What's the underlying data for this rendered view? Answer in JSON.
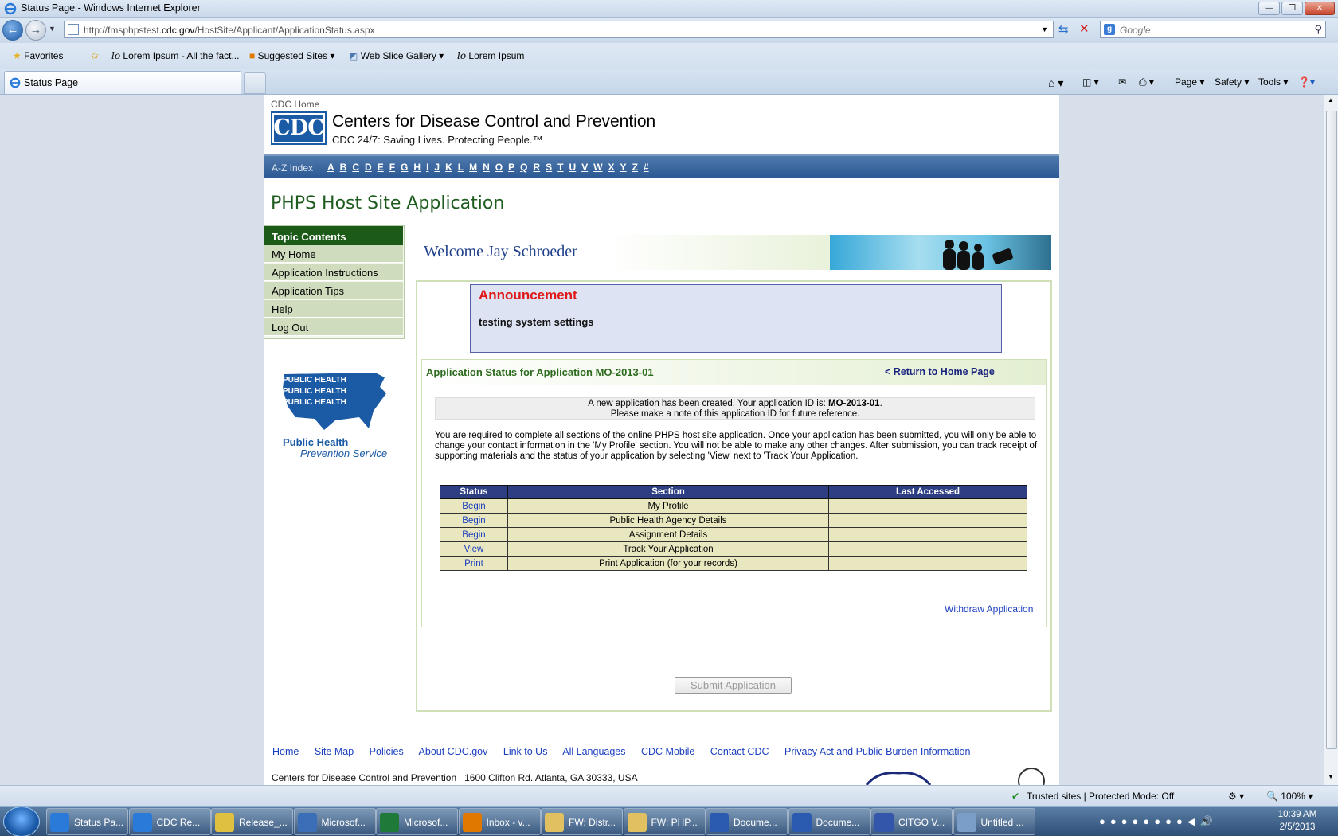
{
  "window": {
    "title": "Status Page - Windows Internet Explorer"
  },
  "browser": {
    "url_prefix": "http://fmsphpstest.",
    "url_domain": "cdc.gov",
    "url_path": "/HostSite/Applicant/ApplicationStatus.aspx",
    "search_placeholder": "Google"
  },
  "favorites": {
    "favorites_label": "Favorites",
    "items": [
      "Lorem Ipsum - All the fact...",
      "Suggested Sites",
      "Web Slice Gallery",
      "Lorem Ipsum"
    ]
  },
  "tabs": {
    "active": "Status Page"
  },
  "commandbar": {
    "page": "Page",
    "safety": "Safety",
    "tools": "Tools"
  },
  "site": {
    "cdc_home": "CDC Home",
    "logo_text": "CDC",
    "org_name": "Centers for Disease Control and Prevention",
    "tagline": "CDC 24/7: Saving Lives. Protecting People.™",
    "az_label": "A-Z Index",
    "az_letters": [
      "A",
      "B",
      "C",
      "D",
      "E",
      "F",
      "G",
      "H",
      "I",
      "J",
      "K",
      "L",
      "M",
      "N",
      "O",
      "P",
      "Q",
      "R",
      "S",
      "T",
      "U",
      "V",
      "W",
      "X",
      "Y",
      "Z",
      "#"
    ],
    "app_title": "PHPS Host Site Application"
  },
  "leftnav": {
    "header": "Topic Contents",
    "items": [
      "My Home",
      "Application Instructions",
      "Application Tips",
      "Help",
      "Log Out"
    ]
  },
  "phps_logo": {
    "line1": "Public Health",
    "line2": "Prevention Service",
    "stamp": "PUBLIC HEALTH"
  },
  "main": {
    "welcome": "Welcome Jay Schroeder",
    "announcement_title": "Announcement",
    "announcement_body": "testing system settings",
    "status_title": "Application Status for Application MO-2013-01",
    "return_link": "< Return to Home Page",
    "notice_line1_pre": "A new application has been created. Your application ID is: ",
    "notice_id": "MO-2013-01",
    "notice_line1_post": ".",
    "notice_line2": "Please make a note of this application ID for future reference.",
    "instructions": "You are required to complete all sections of the online PHPS host site application. Once your application has been submitted, you will only be able to change your contact information in the 'My Profile' section. You will not be able to make any other changes. After submission, you can track receipt of supporting materials and the status of your application by selecting 'View' next to 'Track Your Application.'",
    "table": {
      "headers": [
        "Status",
        "Section",
        "Last Accessed"
      ],
      "rows": [
        {
          "status": "Begin",
          "section": "My Profile",
          "last": ""
        },
        {
          "status": "Begin",
          "section": "Public Health Agency Details",
          "last": ""
        },
        {
          "status": "Begin",
          "section": "Assignment Details",
          "last": ""
        },
        {
          "status": "View",
          "section": "Track Your Application",
          "last": ""
        },
        {
          "status": "Print",
          "section": "Print Application (for your records)",
          "last": ""
        }
      ]
    },
    "withdraw": "Withdraw Application",
    "submit": "Submit Application"
  },
  "footer": {
    "links": [
      "Home",
      "Site Map",
      "Policies",
      "About CDC.gov",
      "Link to Us",
      "All Languages",
      "CDC Mobile",
      "Contact CDC",
      "Privacy Act and Public Burden Information"
    ],
    "address": "Centers for Disease Control and Prevention   1600 Clifton Rd. Atlanta, GA 30333, USA"
  },
  "statusbar": {
    "zone": "Trusted sites | Protected Mode: Off",
    "zoom": "100%"
  },
  "taskbar": {
    "items": [
      "Status Pa...",
      "CDC Re...",
      "Release_...",
      "Microsof...",
      "Microsof...",
      "Inbox - v...",
      "FW: Distr...",
      "FW: PHP...",
      "Docume...",
      "Docume...",
      "CITGO V...",
      "Untitled ..."
    ],
    "time": "10:39 AM",
    "date": "2/5/2013"
  },
  "colors": {
    "cdc_blue": "#1b5aa5",
    "nav_green": "#1b5a17",
    "table_header": "#2d3f82",
    "table_row": "#e9e7bf",
    "announce_red": "#e01818"
  }
}
